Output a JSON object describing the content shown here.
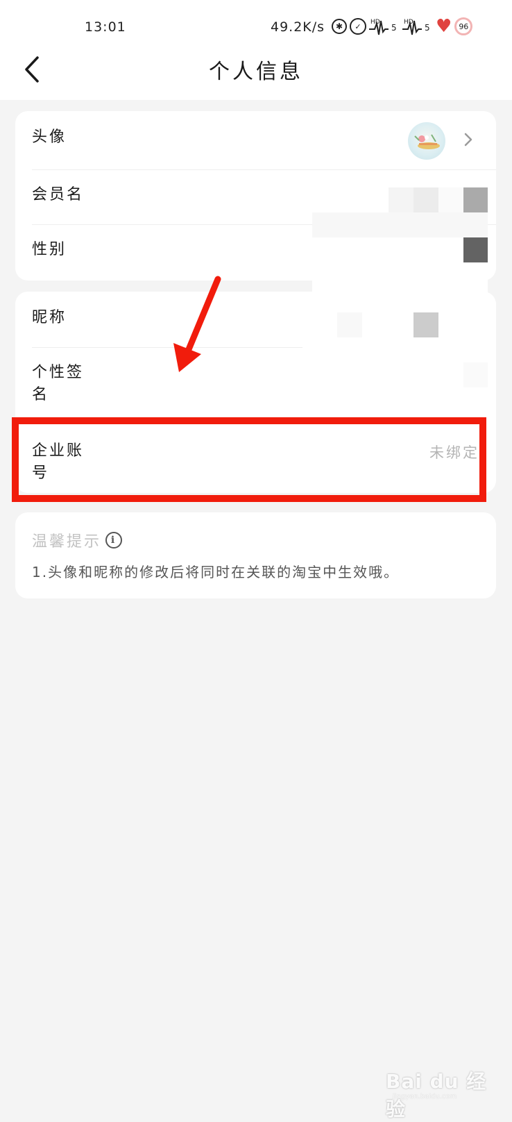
{
  "status_bar": {
    "time": "13:01",
    "network_speed": "49.2K/s",
    "icons": [
      "bluetooth-icon",
      "alarm-icon",
      "hd-signal-icon",
      "hd-signal-icon",
      "heart-icon",
      "battery-icon"
    ],
    "signal_label_1": "HD",
    "signal_label_2": "5",
    "signal_label_3": "HD",
    "signal_label_4": "5",
    "battery": "96"
  },
  "header": {
    "title": "个人信息",
    "back_icon": "chevron-left-icon"
  },
  "profile_card": {
    "rows": [
      {
        "label": "头像"
      },
      {
        "label": "会员名"
      },
      {
        "label": "性别"
      }
    ]
  },
  "detail_card": {
    "rows": [
      {
        "label": "昵称"
      },
      {
        "label": "个性签\n名"
      },
      {
        "label": "企业账\n号",
        "value": "未绑定"
      }
    ]
  },
  "tips": {
    "title": "温馨提示",
    "text": "1.头像和昵称的修改后将同时在关联的淘宝中生效哦。"
  },
  "colors": {
    "page_background": "#f4f4f4",
    "card_background": "#ffffff",
    "annotation_red": "#f11c0c",
    "muted_text": "#b4b4b4"
  },
  "watermark": {
    "text": "Bai du 经验",
    "sub": "jingyan.baidu.com"
  }
}
